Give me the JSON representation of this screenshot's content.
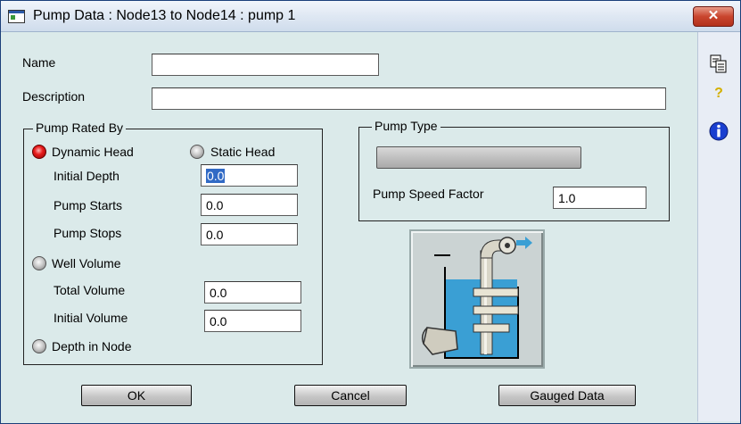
{
  "window": {
    "title": "Pump Data : Node13 to Node14 : pump 1",
    "close_glyph": "✕"
  },
  "fields": {
    "name": {
      "label": "Name",
      "value": ""
    },
    "description": {
      "label": "Description",
      "value": ""
    }
  },
  "pump_rated_by": {
    "legend": "Pump Rated By",
    "dynamic_head": {
      "label": "Dynamic Head",
      "selected": true
    },
    "static_head": {
      "label": "Static Head",
      "selected": false
    },
    "initial_depth": {
      "label": "Initial Depth",
      "value": "0.0"
    },
    "pump_starts": {
      "label": "Pump Starts",
      "value": "0.0"
    },
    "pump_stops": {
      "label": "Pump Stops",
      "value": "0.0"
    },
    "well_volume": {
      "label": "Well Volume",
      "selected": false
    },
    "total_volume": {
      "label": "Total Volume",
      "value": "0.0"
    },
    "initial_volume": {
      "label": "Initial Volume",
      "value": "0.0"
    },
    "depth_in_node": {
      "label": "Depth in Node",
      "selected": false
    }
  },
  "pump_type": {
    "legend": "Pump Type",
    "selected_value": "",
    "speed_factor": {
      "label": "Pump Speed Factor",
      "value": "1.0"
    }
  },
  "buttons": {
    "ok": "OK",
    "cancel": "Cancel",
    "gauged": "Gauged Data"
  },
  "side_icons": [
    "copy-icon",
    "help-icon",
    "info-icon"
  ],
  "colors": {
    "background": "#dbeaea",
    "selection": "#316ac5",
    "radio_selected": "#e81d1d",
    "water": "#3a9fd4"
  }
}
